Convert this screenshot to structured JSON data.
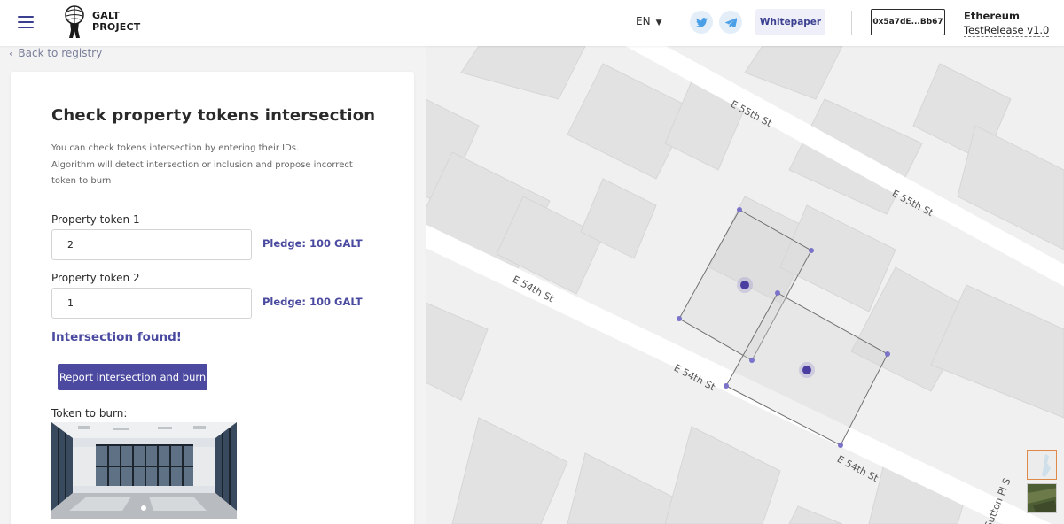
{
  "header": {
    "logo_line1": "GALT",
    "logo_line2": "PROJECT",
    "language": "EN",
    "whitepaper_label": "Whitepaper",
    "address": "0x5a7dE...Bb67",
    "network_name": "Ethereum",
    "network_release": "TestRelease v1.0"
  },
  "nav": {
    "back_label": "Back to registry"
  },
  "form": {
    "title": "Check property tokens intersection",
    "description_line1": "You can check tokens intersection by entering their IDs.",
    "description_line2": "Algorithm will detect intersection or inclusion and propose incorrect token to burn",
    "token1_label": "Property token 1",
    "token1_value": "2",
    "token1_pledge": "Pledge: 100 GALT",
    "token2_label": "Property token 2",
    "token2_value": "1",
    "token2_pledge": "Pledge: 100 GALT",
    "result_text": "Intersection found!",
    "report_button": "Report intersection and burn",
    "burn_label": "Token to burn:"
  },
  "map": {
    "streets": {
      "s1": "E 55th St",
      "s2": "E 55th St",
      "s3": "E 54th St",
      "s4": "E 54th St",
      "s5": "E 54th St",
      "s6": "Sutton Pl S"
    }
  },
  "colors": {
    "accent": "#4c4aa0",
    "pledge": "#4a4aa0",
    "map_bg": "#f0f0f0",
    "building": "#e1e1e1",
    "road": "#ffffff",
    "polygon_line": "#707070",
    "vertex": "#7a73c9",
    "marker": "#4a3fa0"
  },
  "icons": {
    "menu": "hamburger-icon",
    "logo": "atlas-logo-icon",
    "twitter": "twitter-icon",
    "telegram": "telegram-icon",
    "back": "chevron-left-icon",
    "caret": "caret-down-icon"
  }
}
